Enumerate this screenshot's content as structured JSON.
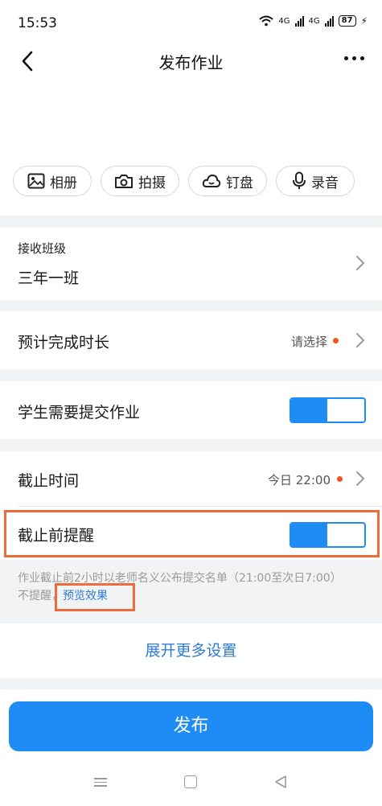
{
  "status_bar": {
    "time": "15:53",
    "net1": "4G",
    "net2": "4G",
    "battery": "87"
  },
  "nav": {
    "title": "发布作业"
  },
  "media": {
    "album": "相册",
    "camera": "拍摄",
    "dingpan": "钉盘",
    "record": "录音"
  },
  "receive_class": {
    "label": "接收班级",
    "value": "三年一班"
  },
  "duration": {
    "label": "预计完成时长",
    "value": "请选择"
  },
  "submit_required": {
    "label": "学生需要提交作业",
    "enabled": true
  },
  "deadline": {
    "label": "截止时间",
    "value": "今日 22:00"
  },
  "reminder": {
    "label": "截止前提醒",
    "enabled": true,
    "note_line1": "作业截止前2小时以老师名义公布提交名单（21:00至次日7:00）",
    "note_line2": "不提醒，",
    "preview_link": "预览效果"
  },
  "expand_more": "展开更多设置",
  "publish_button": "发布",
  "colors": {
    "accent": "#1f8cf5",
    "link": "#2f7ad8",
    "dot": "#f4511e",
    "highlight": "#ee6b3b"
  }
}
